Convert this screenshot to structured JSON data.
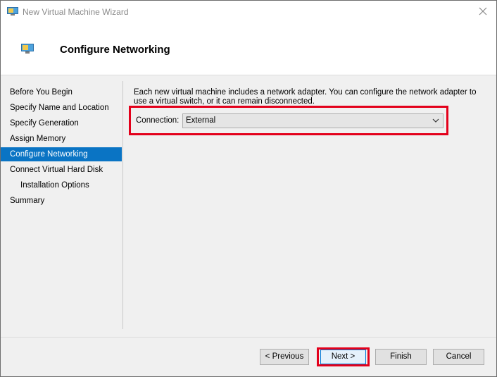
{
  "window": {
    "title": "New Virtual Machine Wizard",
    "heading": "Configure Networking"
  },
  "nav": {
    "items": [
      {
        "label": "Before You Begin"
      },
      {
        "label": "Specify Name and Location"
      },
      {
        "label": "Specify Generation"
      },
      {
        "label": "Assign Memory"
      },
      {
        "label": "Configure Networking",
        "active": true
      },
      {
        "label": "Connect Virtual Hard Disk"
      },
      {
        "label": "Installation Options",
        "indent": true
      },
      {
        "label": "Summary"
      }
    ]
  },
  "content": {
    "intro": "Each new virtual machine includes a network adapter. You can configure the network adapter to use a virtual switch, or it can remain disconnected.",
    "connection_label": "Connection:",
    "connection_value": "External"
  },
  "buttons": {
    "previous": "< Previous",
    "next": "Next >",
    "finish": "Finish",
    "cancel": "Cancel"
  },
  "colors": {
    "accent": "#0a74c4",
    "highlight": "#e3001b",
    "body_bg": "#f0f0f0"
  },
  "icons": {
    "app": "monitor-icon",
    "close": "close-icon",
    "dropdown": "chevron-down-icon"
  }
}
